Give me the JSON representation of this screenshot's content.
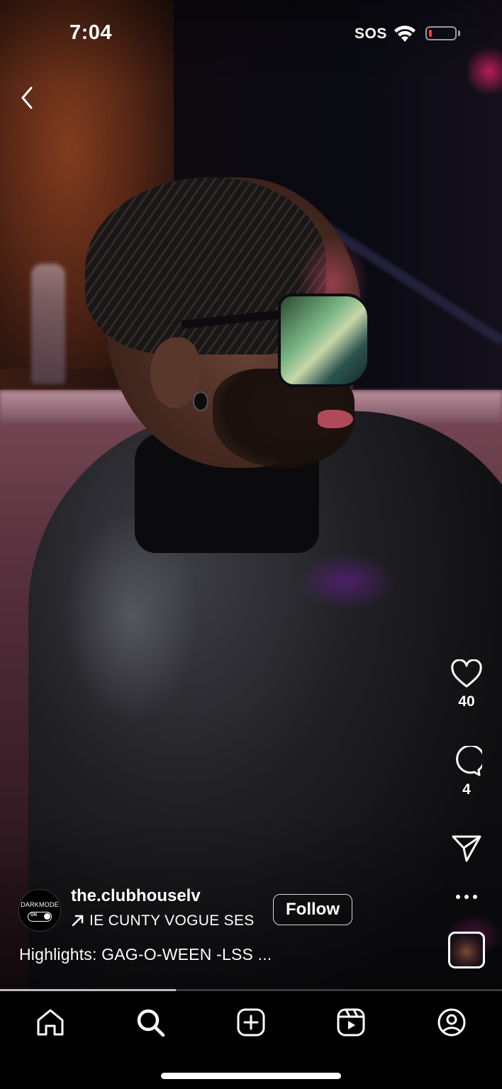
{
  "status_bar": {
    "time": "7:04",
    "network": "SOS",
    "battery_level": 0.1
  },
  "reel": {
    "username": "the.clubhouselv",
    "avatar_text": "DARKMODE",
    "avatar_toggle_text": "ON",
    "audio_title": "IE CUNTY VOGUE SES",
    "follow_label": "Follow",
    "caption": "Highlights: GAG-O-WEEN -LSS ...",
    "progress": 0.35
  },
  "actions": {
    "likes": "40",
    "comments": "4"
  },
  "icons": {
    "back": "chevron-left-icon",
    "like": "heart-icon",
    "comment": "comment-bubble-icon",
    "share": "paper-plane-icon",
    "more": "more-horizontal-icon",
    "audio": "arrow-up-right-icon"
  },
  "tab_bar": [
    "home",
    "search",
    "create",
    "reels",
    "profile"
  ],
  "colors": {
    "battery_low": "#ff3b30",
    "background": "#000000",
    "text": "#ffffff"
  }
}
